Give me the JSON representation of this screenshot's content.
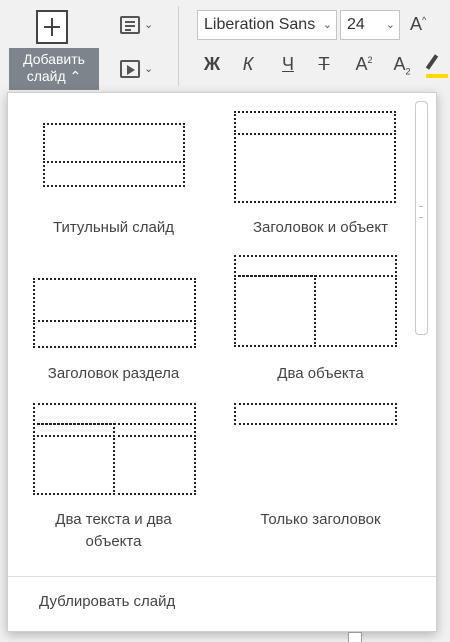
{
  "toolbar": {
    "add_slide": {
      "line1": "Добавить",
      "line2": "слайд",
      "chevron": "⌃",
      "icon": "plus-icon"
    },
    "layout_button": {
      "icon": "layout-icon",
      "chevron": "⌄"
    },
    "slideshow_button": {
      "icon": "slideshow-icon",
      "chevron": "⌄"
    },
    "font_name": {
      "value": "Liberation Sans"
    },
    "font_size": {
      "value": "24"
    },
    "grow_font": "A",
    "bold": "Ж",
    "italic": "К",
    "underline": "Ч",
    "strike": "Т",
    "superscript": "A",
    "subscript": "A",
    "highlight_color": "#ffd800"
  },
  "layouts": [
    {
      "caption": "Титульный слайд"
    },
    {
      "caption": "Заголовок и объект"
    },
    {
      "caption": "Заголовок раздела"
    },
    {
      "caption": "Два объекта"
    },
    {
      "caption": "Два текста и два объекта"
    },
    {
      "caption": "Только заголовок"
    }
  ],
  "duplicate_label": "Дублировать слайд"
}
